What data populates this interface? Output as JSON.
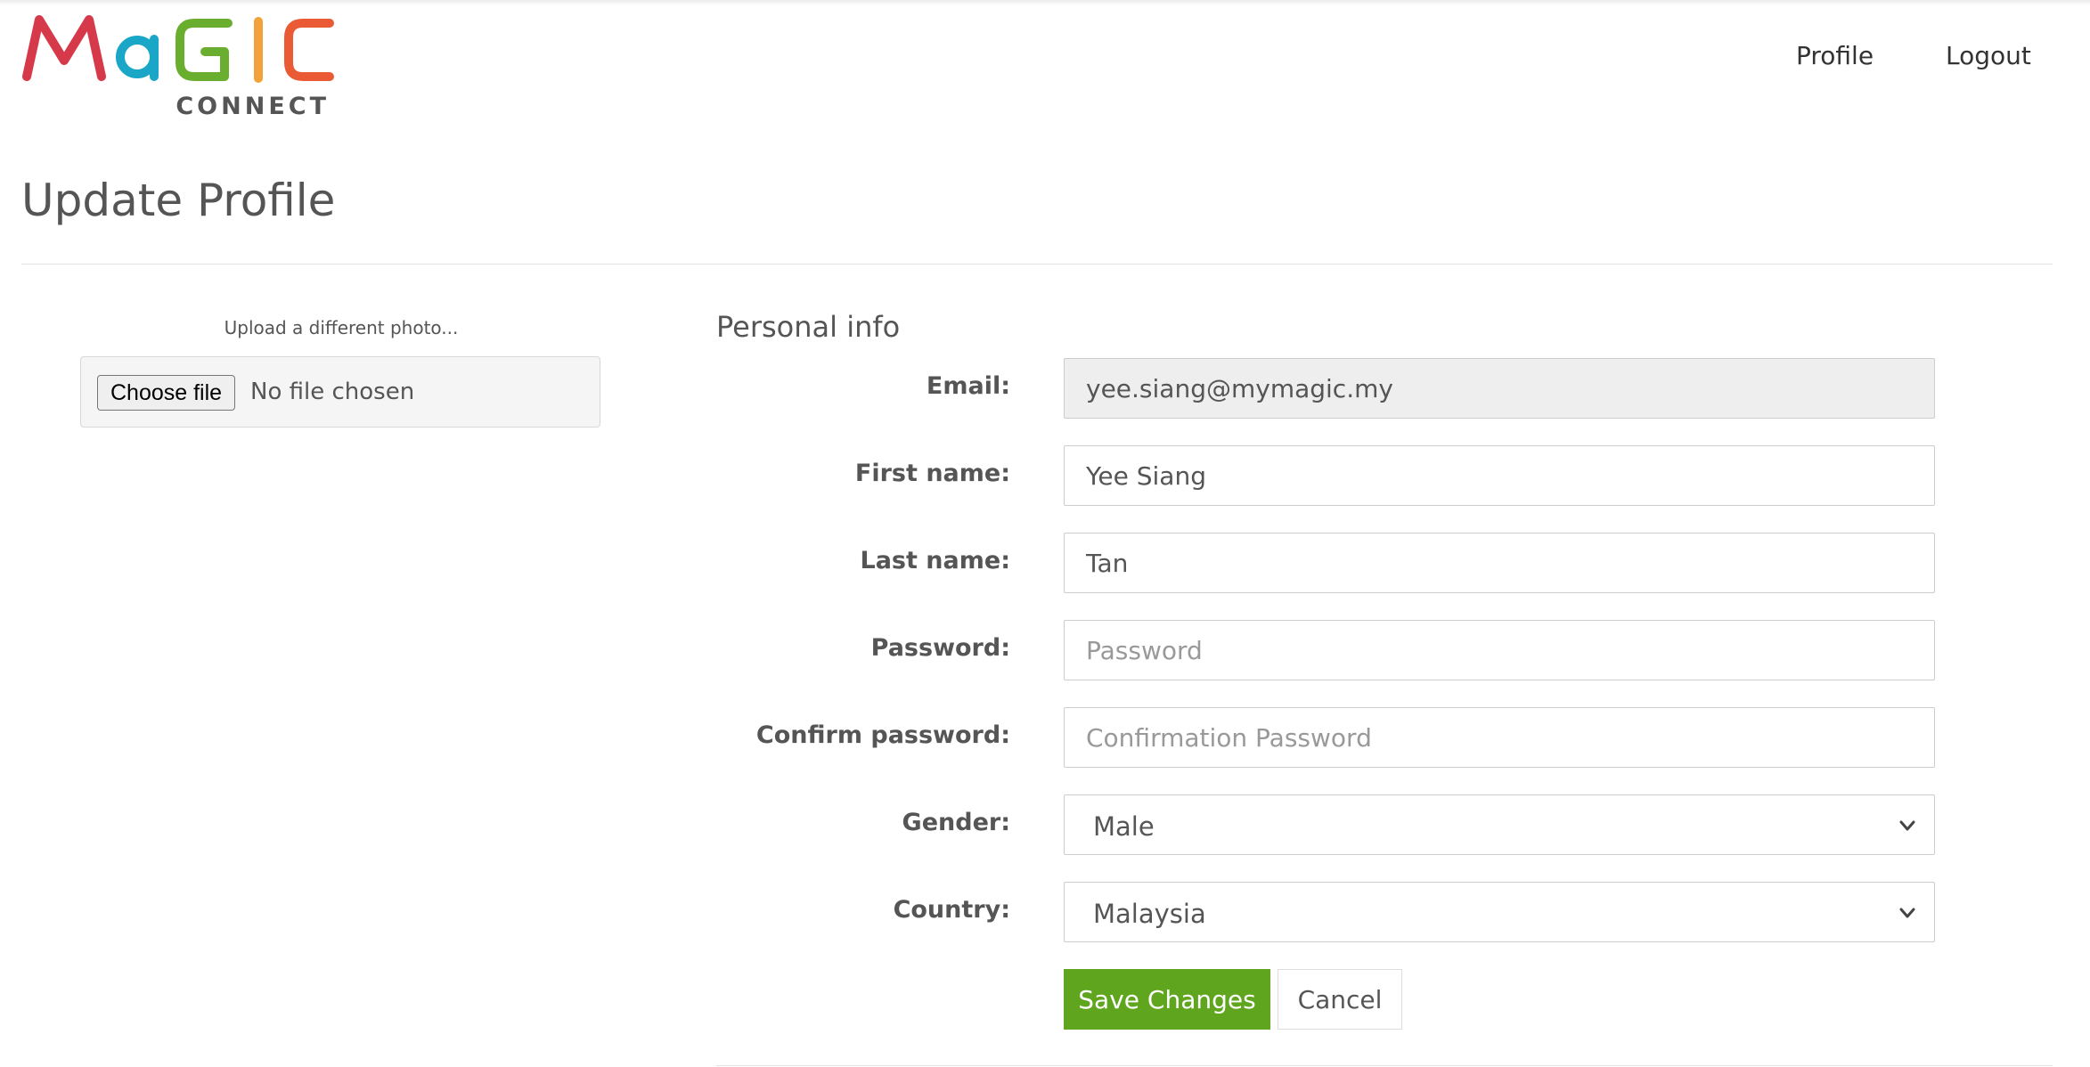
{
  "brand": {
    "logo_text": "MaGIC",
    "logo_subtext": "CONNECT",
    "colors": {
      "m": "#d6394a",
      "a": "#1aa6c6",
      "g": "#6aae2f",
      "i": "#f2a23a",
      "c": "#ea5a35",
      "connect": "#555555"
    }
  },
  "nav": {
    "profile": "Profile",
    "logout": "Logout"
  },
  "page": {
    "title": "Update Profile"
  },
  "photo": {
    "label": "Upload a different photo...",
    "choose_button": "Choose file",
    "status": "No file chosen"
  },
  "form": {
    "section_title": "Personal info",
    "email": {
      "label": "Email:",
      "value": "yee.siang@mymagic.my"
    },
    "first_name": {
      "label": "First name:",
      "value": "Yee Siang"
    },
    "last_name": {
      "label": "Last name:",
      "value": "Tan"
    },
    "password": {
      "label": "Password:",
      "value": "",
      "placeholder": "Password"
    },
    "confirm_password": {
      "label": "Confirm password:",
      "value": "",
      "placeholder": "Confirmation Password"
    },
    "gender": {
      "label": "Gender:",
      "value": "Male"
    },
    "country": {
      "label": "Country:",
      "value": "Malaysia"
    },
    "save_label": "Save Changes",
    "cancel_label": "Cancel"
  },
  "theme": {
    "accent_green": "#5fa51e",
    "text_gray": "#555555"
  }
}
